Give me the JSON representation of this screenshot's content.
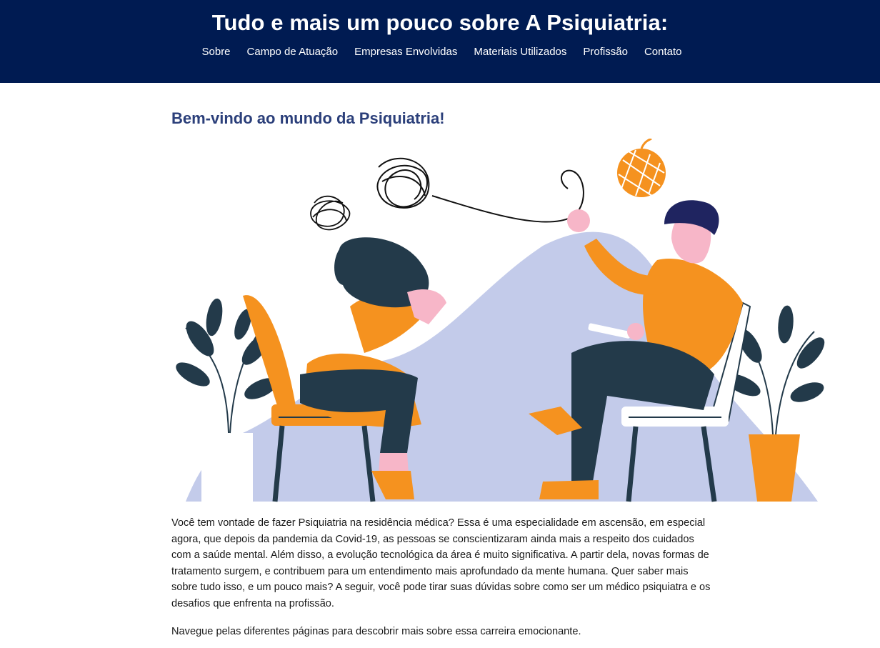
{
  "header": {
    "title": "Tudo e mais um pouco sobre A Psiquiatria:",
    "background": "#001b52"
  },
  "nav": {
    "items": [
      {
        "label": "Sobre"
      },
      {
        "label": "Campo de Atuação"
      },
      {
        "label": "Empresas Envolvidas"
      },
      {
        "label": "Materiais Utilizados"
      },
      {
        "label": "Profissão"
      },
      {
        "label": "Contato"
      }
    ]
  },
  "main": {
    "heading": "Bem-vindo ao mundo da Psiquiatria!",
    "heading_color": "#2b3f7a",
    "paragraphs": [
      "Você tem vontade de fazer Psiquiatria na residência médica? Essa é uma especialidade em ascensão, em especial agora, que depois da pandemia da Covid-19, as pessoas se conscientizaram ainda mais a respeito dos cuidados com a saúde mental. Além disso, a evolução tecnológica da área é muito significativa. A partir dela, novas formas de tratamento surgem, e contribuem para um entendimento mais aprofundado da mente humana. Quer saber mais sobre tudo isso, e um pouco mais? A seguir, você pode tirar suas dúvidas sobre como ser um médico psiquiatra e os desafios que enfrenta na profissão.",
      "Navegue pelas diferentes páginas para descobrir mais sobre essa carreira emocionante."
    ]
  },
  "illustration": {
    "subject": "therapy-session-illustration",
    "colors": {
      "blob": "#c3cbea",
      "orange": "#f5921f",
      "navy": "#233a4a",
      "skin": "#f7b6c8",
      "hair_man": "#1f2460"
    }
  }
}
